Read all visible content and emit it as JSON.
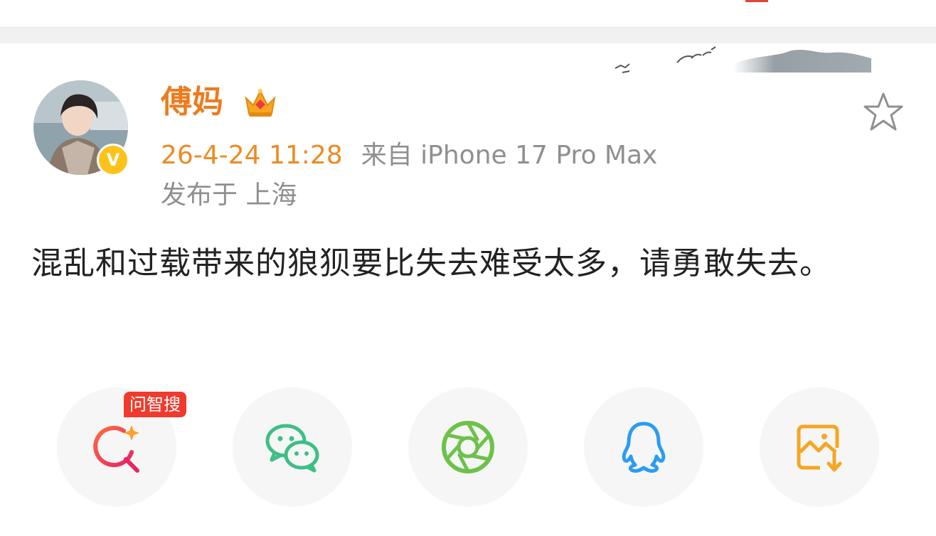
{
  "post": {
    "username": "傅妈",
    "time": "26-4-24 11:28",
    "source": "来自 iPhone 17 Pro Max",
    "location": "发布于 上海",
    "content": "混乱和过载带来的狼狈要比失去难受太多，请勇敢失去。",
    "verified_mark": "V"
  },
  "share": {
    "search_tag": "问智搜",
    "buttons": [
      {
        "icon": "ai-search-icon",
        "color": "#f0504a"
      },
      {
        "icon": "wechat-icon",
        "color": "#3dbf85"
      },
      {
        "icon": "moments-icon",
        "color": "#6cc24a"
      },
      {
        "icon": "qq-icon",
        "color": "#2a9cf4"
      },
      {
        "icon": "save-image-icon",
        "color": "#f5a623"
      }
    ]
  },
  "colors": {
    "username": "#ec7c1e",
    "time": "#ee8a22",
    "meta_gray": "#8f8f8f",
    "text": "#222222"
  }
}
